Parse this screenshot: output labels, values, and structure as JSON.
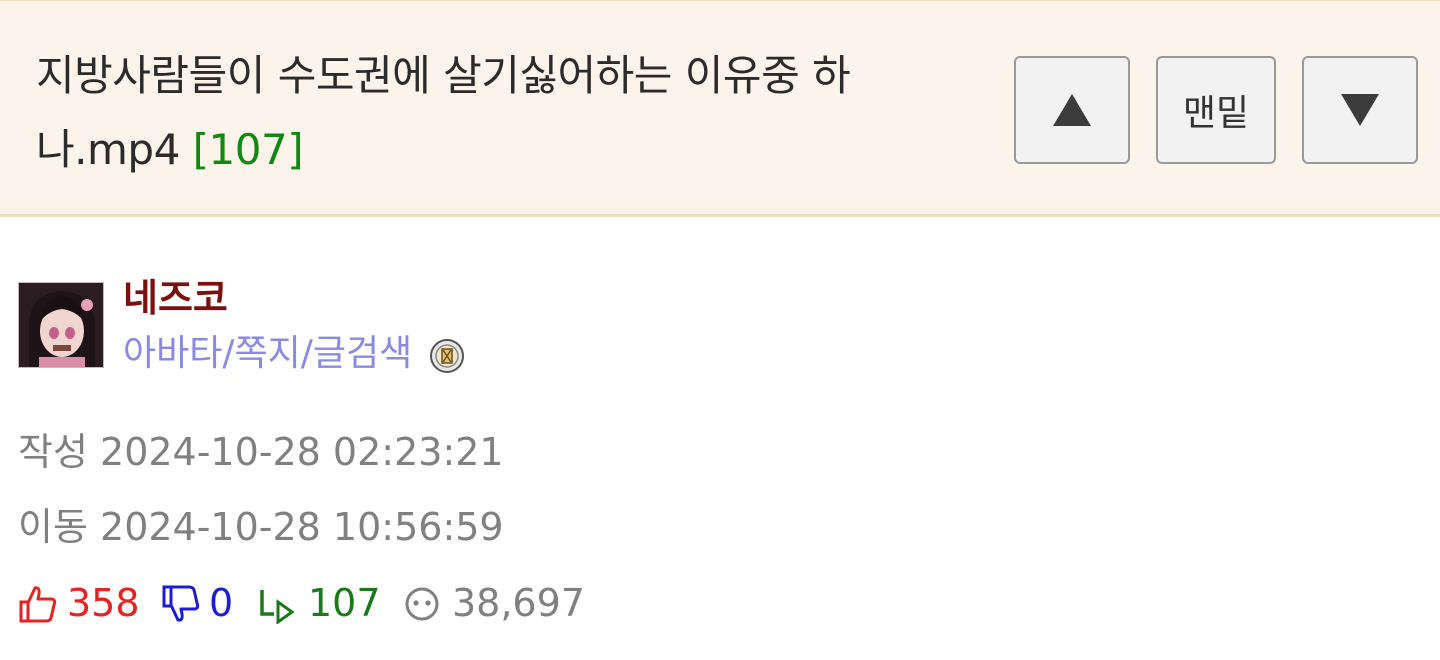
{
  "post": {
    "title_main": "지방사람들이 수도권에 살기싫어하는 이유중 하나.mp4",
    "title_count": "[107]"
  },
  "nav": {
    "up_icon": "triangle-up-icon",
    "bottom_label": "맨밑",
    "down_icon": "triangle-down-icon"
  },
  "author": {
    "nickname": "네즈코",
    "link_avatar": "아바타",
    "sep1": "/",
    "link_message": "쪽지",
    "sep2": "/",
    "link_search": "글검색",
    "badge_icon": "level-badge-icon"
  },
  "meta": {
    "written_label": "작성",
    "written_value": "2024-10-28 02:23:21",
    "moved_label": "이동",
    "moved_value": "2024-10-28 10:56:59"
  },
  "stats": {
    "likes": "358",
    "dislikes": "0",
    "replies": "107",
    "views": "38,697"
  },
  "colors": {
    "header_bg": "#fcf3ea",
    "count_green": "#118811",
    "nick": "#7a1010",
    "link": "#8a8ae6",
    "like_red": "#e62222",
    "dislike_blue": "#1c1cd6",
    "reply_green": "#1a7a1a",
    "muted": "#808080"
  }
}
